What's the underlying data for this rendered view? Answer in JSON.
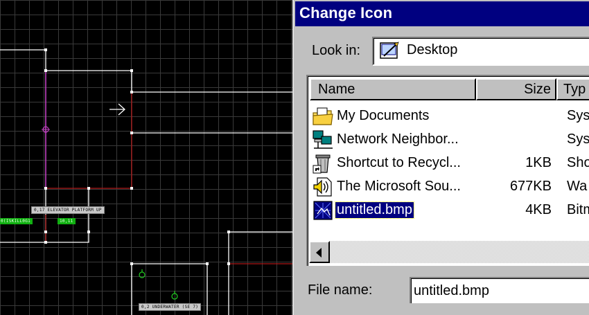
{
  "editor": {
    "sector_labels": {
      "elevator": "0,17 ELEVATOR PLATFORM UP",
      "green_left": "0(ISKILL0G1",
      "green_right": "10,11",
      "underwater": "0,2 UNDERWATER (SE 7)"
    },
    "colors": {
      "wall": "#ffffff",
      "two_sided": "#b01818",
      "selected": "#c040c0",
      "thing": "#22cc22"
    }
  },
  "dialog": {
    "title": "Change Icon",
    "look_in": {
      "label": "Look in:",
      "value": "Desktop",
      "icon": "folder-desktop-icon"
    },
    "columns": [
      "Name",
      "Size",
      "Typ"
    ],
    "files": [
      {
        "name": "My Documents",
        "size": "",
        "type": "Sys",
        "icon": "my-documents-icon"
      },
      {
        "name": "Network Neighbor...",
        "size": "",
        "type": "Sys",
        "icon": "network-neighborhood-icon"
      },
      {
        "name": "Shortcut to Recycl...",
        "size": "1KB",
        "type": "Sho",
        "icon": "shortcut-recycle-icon"
      },
      {
        "name": "The Microsoft Sou...",
        "size": "677KB",
        "type": "Wa",
        "icon": "sound-file-icon"
      },
      {
        "name": "untitled.bmp",
        "size": "4KB",
        "type": "Bitm",
        "icon": "bitmap-file-icon"
      }
    ],
    "file_name": {
      "label": "File name:",
      "value": "untitled.bmp"
    }
  }
}
